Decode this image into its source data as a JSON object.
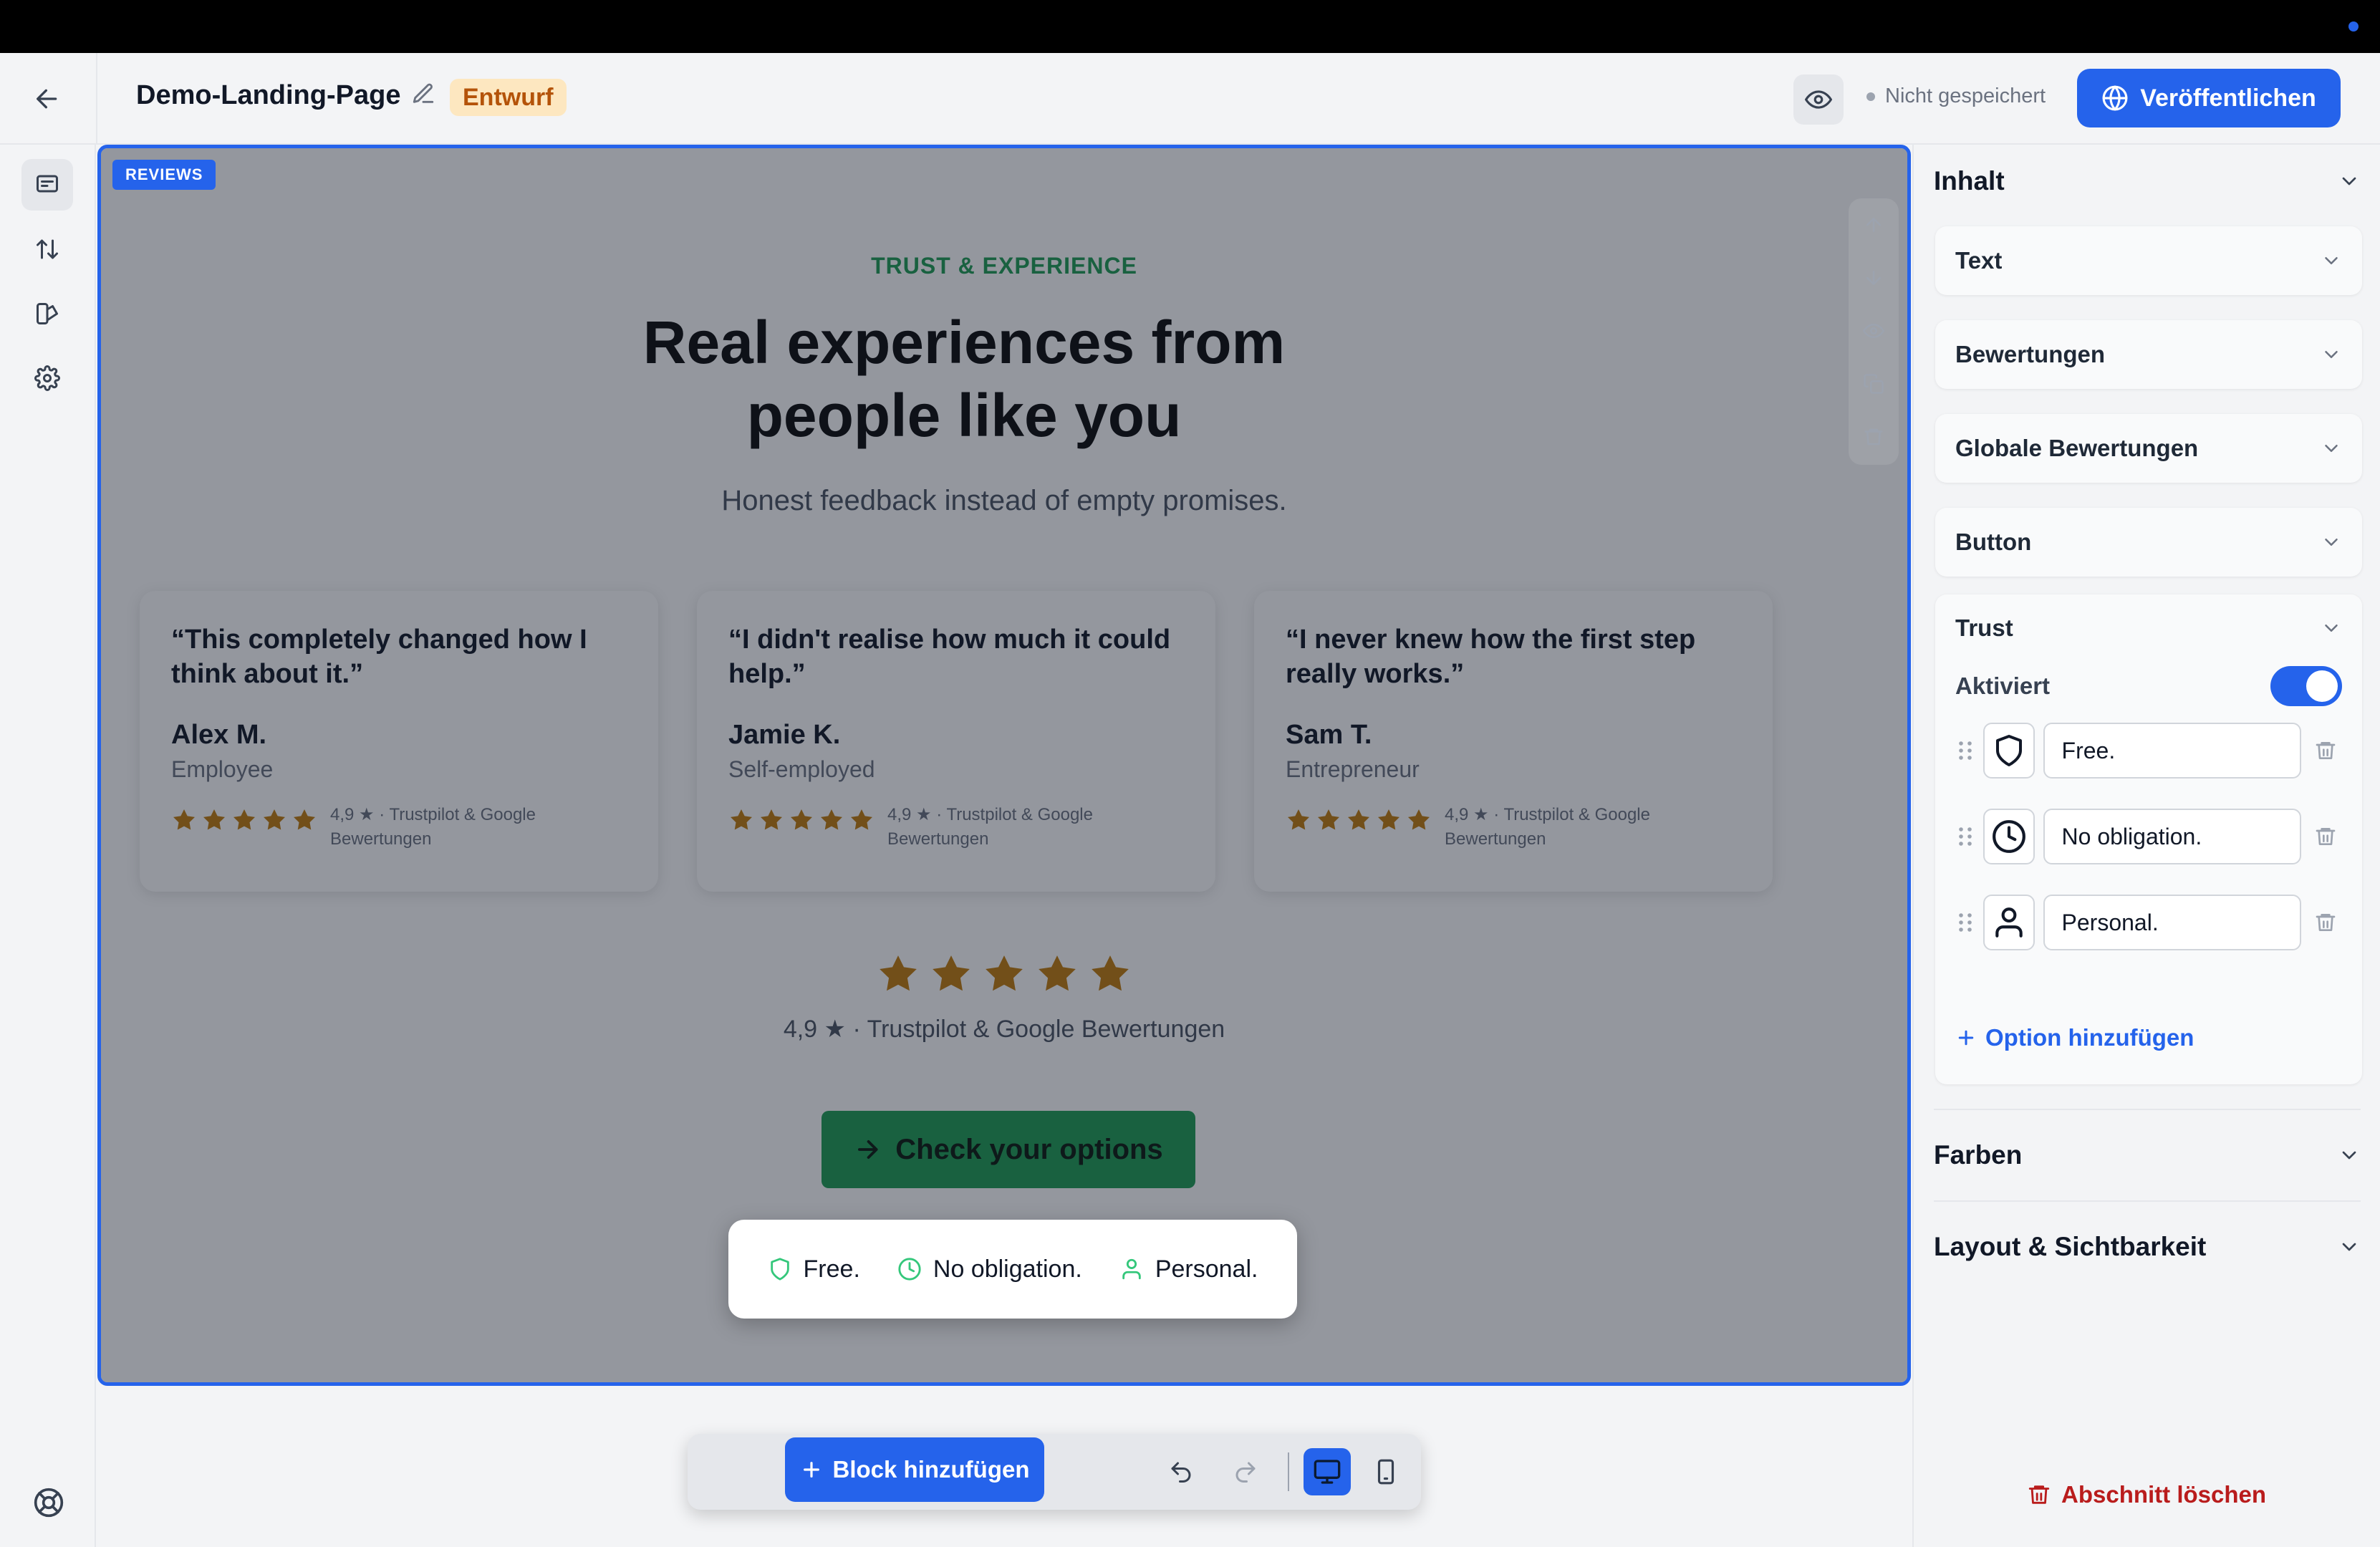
{
  "header": {
    "page_name": "Demo-Landing-Page",
    "status_badge": "Entwurf",
    "save_status": "Nicht gespeichert",
    "publish_label": "Veröffentlichen"
  },
  "section": {
    "tag": "REVIEWS",
    "eyebrow": "TRUST & EXPERIENCE",
    "headline": "Real experiences from people like you",
    "subline": "Honest feedback instead of empty promises.",
    "reviews": [
      {
        "quote": "“This completely changed how I think about it.”",
        "name": "Alex M.",
        "role": "Employee",
        "rating": "4,9 ★ · Trustpilot & Google Bewertungen",
        "stars": 5
      },
      {
        "quote": "“I didn't realise how much it could help.”",
        "name": "Jamie K.",
        "role": "Self-employed",
        "rating": "4,9 ★ · Trustpilot & Google Bewertungen",
        "stars": 5
      },
      {
        "quote": "“I never knew how the first step really works.”",
        "name": "Sam T.",
        "role": "Entrepreneur",
        "rating": "4,9 ★ · Trustpilot & Google Bewertungen",
        "stars": 5
      }
    ],
    "global_rating": "4,9 ★ · Trustpilot & Google Bewertungen",
    "global_stars": 5,
    "cta_label": "Check your options",
    "trust_items": [
      "Free.",
      "No obligation.",
      "Personal."
    ]
  },
  "toolbar": {
    "add_block_label": "Block hinzufügen"
  },
  "panel": {
    "content_title": "Inhalt",
    "groups": [
      "Text",
      "Bewertungen",
      "Globale Bewertungen",
      "Button"
    ],
    "trust_title": "Trust",
    "activated_label": "Aktiviert",
    "activated": true,
    "trust_options": [
      {
        "icon": "shield-icon",
        "value": "Free."
      },
      {
        "icon": "clock-icon",
        "value": "No obligation."
      },
      {
        "icon": "user-icon",
        "value": "Personal."
      }
    ],
    "add_option_label": "Option hinzufügen",
    "colors_title": "Farben",
    "layout_title": "Layout & Sichtbarkeit",
    "delete_section_label": "Abschnitt löschen"
  },
  "colors": {
    "accent": "#2563eb",
    "green": "#1f9d55",
    "star": "#c27c0e",
    "danger": "#b91c1c"
  }
}
